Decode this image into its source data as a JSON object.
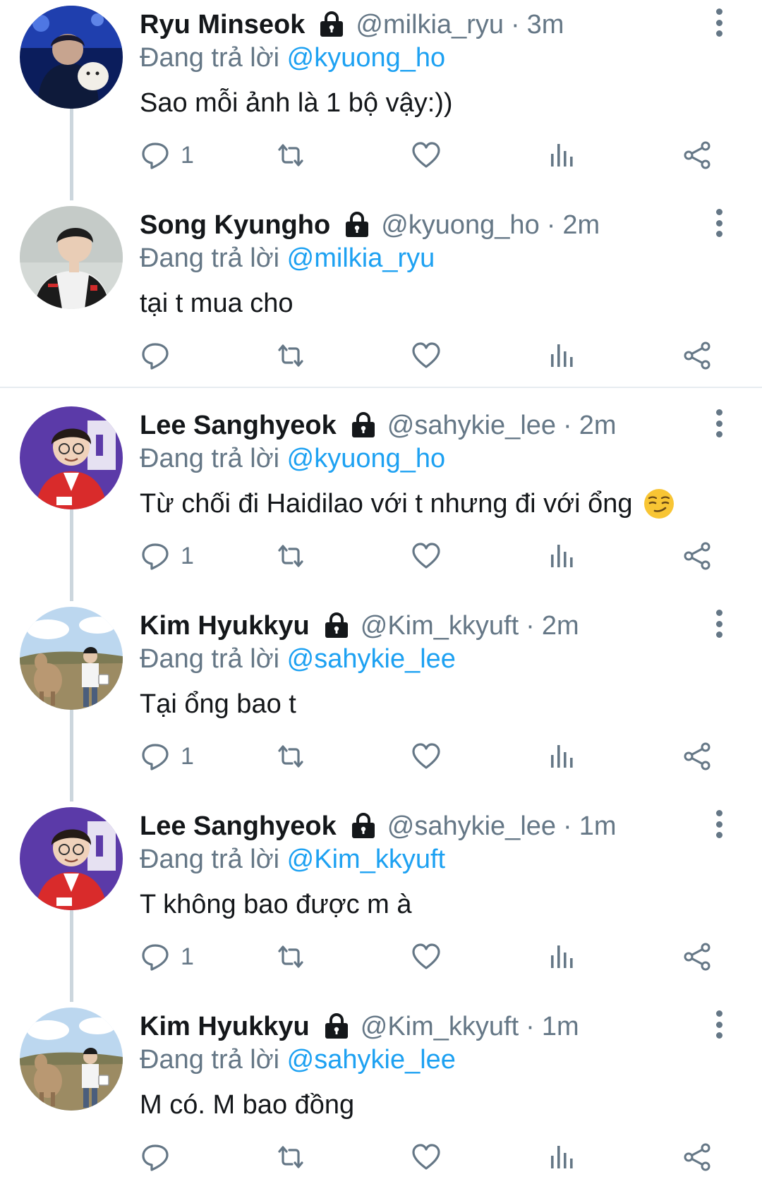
{
  "tweets": [
    {
      "name": "Ryu Minseok",
      "handle": "@milkia_ryu",
      "separator": "·",
      "time": "3m",
      "reply_prefix": "Đang trả lời",
      "reply_to": "@kyuong_ho",
      "text": "Sao mỗi ảnh là 1 bộ vậy:))",
      "reply_count": "1",
      "avatar": "avatar-blue-stage"
    },
    {
      "name": "Song Kyungho",
      "handle": "@kyuong_ho",
      "separator": "·",
      "time": "2m",
      "reply_prefix": "Đang trả lời",
      "reply_to": "@milkia_ryu",
      "text": "tại t mua cho",
      "reply_count": "",
      "avatar": "avatar-jersey"
    },
    {
      "name": "Lee Sanghyeok",
      "handle": "@sahykie_lee",
      "separator": "·",
      "time": "2m",
      "reply_prefix": "Đang trả lời",
      "reply_to": "@kyuong_ho",
      "text": "Từ chối đi Haidilao với t nhưng đi với ổng",
      "emoji": "smirking-face-icon",
      "reply_count": "1",
      "avatar": "avatar-red-jacket"
    },
    {
      "name": "Kim Hyukkyu",
      "handle": "@Kim_kkyuft",
      "separator": "·",
      "time": "2m",
      "reply_prefix": "Đang trả lời",
      "reply_to": "@sahykie_lee",
      "text": "Tại ổng bao t",
      "reply_count": "1",
      "avatar": "avatar-alpaca-field"
    },
    {
      "name": "Lee Sanghyeok",
      "handle": "@sahykie_lee",
      "separator": "·",
      "time": "1m",
      "reply_prefix": "Đang trả lời",
      "reply_to": "@Kim_kkyuft",
      "text": "T không bao được m à",
      "reply_count": "1",
      "avatar": "avatar-red-jacket"
    },
    {
      "name": "Kim Hyukkyu",
      "handle": "@Kim_kkyuft",
      "separator": "·",
      "time": "1m",
      "reply_prefix": "Đang trả lời",
      "reply_to": "@sahykie_lee",
      "text": "M có. M bao đồng",
      "reply_count": "",
      "avatar": "avatar-alpaca-field"
    }
  ],
  "colors": {
    "name": "#14171a",
    "secondary": "#657786",
    "link": "#1da1f2",
    "thread_line": "#ccd6dd",
    "divider": "#e6ecf0"
  },
  "icons": [
    "lock-icon",
    "more-options-icon",
    "reply-icon",
    "retweet-icon",
    "like-icon",
    "analytics-icon",
    "share-icon"
  ]
}
